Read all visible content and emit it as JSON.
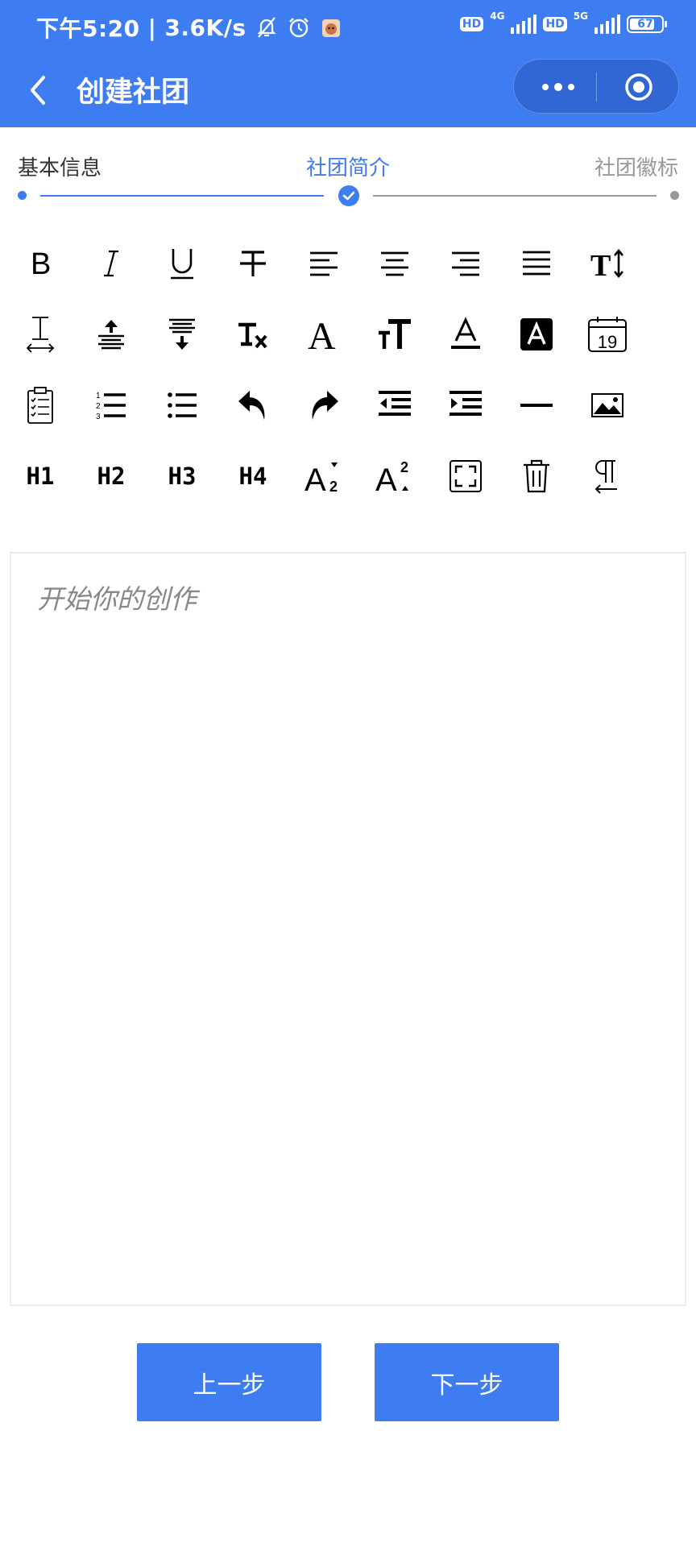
{
  "status_bar": {
    "time": "下午5:20",
    "speed": "3.6K/s",
    "sim1_badge": "HD",
    "sim1_net": "4G",
    "sim2_badge": "HD",
    "sim2_net": "5G",
    "battery": "67"
  },
  "nav": {
    "title": "创建社团"
  },
  "steps": [
    {
      "label": "基本信息",
      "state": "done"
    },
    {
      "label": "社团简介",
      "state": "current"
    },
    {
      "label": "社团徽标",
      "state": "todo"
    }
  ],
  "toolbar": {
    "headings": [
      "H1",
      "H2",
      "H3",
      "H4"
    ],
    "date_day": "19"
  },
  "editor": {
    "placeholder": "开始你的创作"
  },
  "buttons": {
    "prev": "上一步",
    "next": "下一步"
  },
  "colors": {
    "primary": "#3d7cf1",
    "step_inactive": "#999999"
  }
}
